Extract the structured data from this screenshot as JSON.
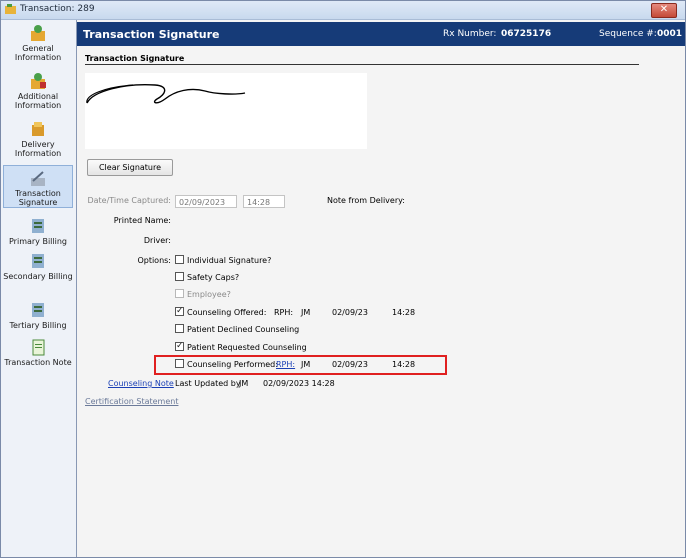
{
  "window": {
    "title": "Transaction: 289",
    "close_glyph": "✕"
  },
  "sidebar": {
    "items": [
      {
        "label": "General Information",
        "icon": "general-info-icon"
      },
      {
        "label": "Additional Information",
        "icon": "additional-info-icon"
      },
      {
        "label": "Delivery Information",
        "icon": "delivery-info-icon"
      },
      {
        "label": "Transaction Signature",
        "icon": "signature-icon",
        "selected": true
      },
      {
        "label": "Primary Billing",
        "icon": "primary-billing-icon"
      },
      {
        "label": "Secondary Billing",
        "icon": "secondary-billing-icon"
      },
      {
        "label": "Tertiary Billing",
        "icon": "tertiary-billing-icon"
      },
      {
        "label": "Transaction Note",
        "icon": "transaction-note-icon"
      }
    ]
  },
  "header": {
    "title": "Transaction Signature",
    "rx_label": "Rx Number:",
    "rx_value": "06725176",
    "seq_label": "Sequence #:",
    "seq_value": "0001"
  },
  "section": {
    "title": "Transaction Signature"
  },
  "buttons": {
    "clear_signature": "Clear Signature"
  },
  "form": {
    "datetime_label": "Date/Time Captured:",
    "date_value": "02/09/2023",
    "time_value": "14:28",
    "note_from_delivery_label": "Note from Delivery:",
    "printed_name_label": "Printed Name:",
    "driver_label": "Driver:",
    "options_label": "Options:"
  },
  "options": {
    "individual_signature": {
      "label": "Individual Signature?",
      "checked": false
    },
    "safety_caps": {
      "label": "Safety Caps?",
      "checked": false
    },
    "employee": {
      "label": "Employee?",
      "checked": false,
      "disabled": true
    },
    "counseling_offered": {
      "label": "Counseling Offered:",
      "checked": true,
      "rph_label": "RPH:",
      "rph": "JM",
      "date": "02/09/23",
      "time": "14:28"
    },
    "patient_declined": {
      "label": "Patient Declined Counseling",
      "checked": false
    },
    "patient_requested": {
      "label": "Patient Requested Counseling",
      "checked": true
    },
    "counseling_performed": {
      "label": "Counseling Performed:",
      "checked": false,
      "rph_label": "RPH:",
      "rph": "JM",
      "date": "02/09/23",
      "time": "14:28"
    }
  },
  "counseling_note": {
    "link": "Counseling Note",
    "updated_label": "Last Updated by",
    "updated_by": "JM",
    "updated_at": "02/09/2023 14:28"
  },
  "certification_link": "Certification Statement",
  "colors": {
    "header_bg": "#163b78",
    "highlight": "#e02020",
    "link": "#1a3fb5"
  },
  "check_glyph": "✓"
}
